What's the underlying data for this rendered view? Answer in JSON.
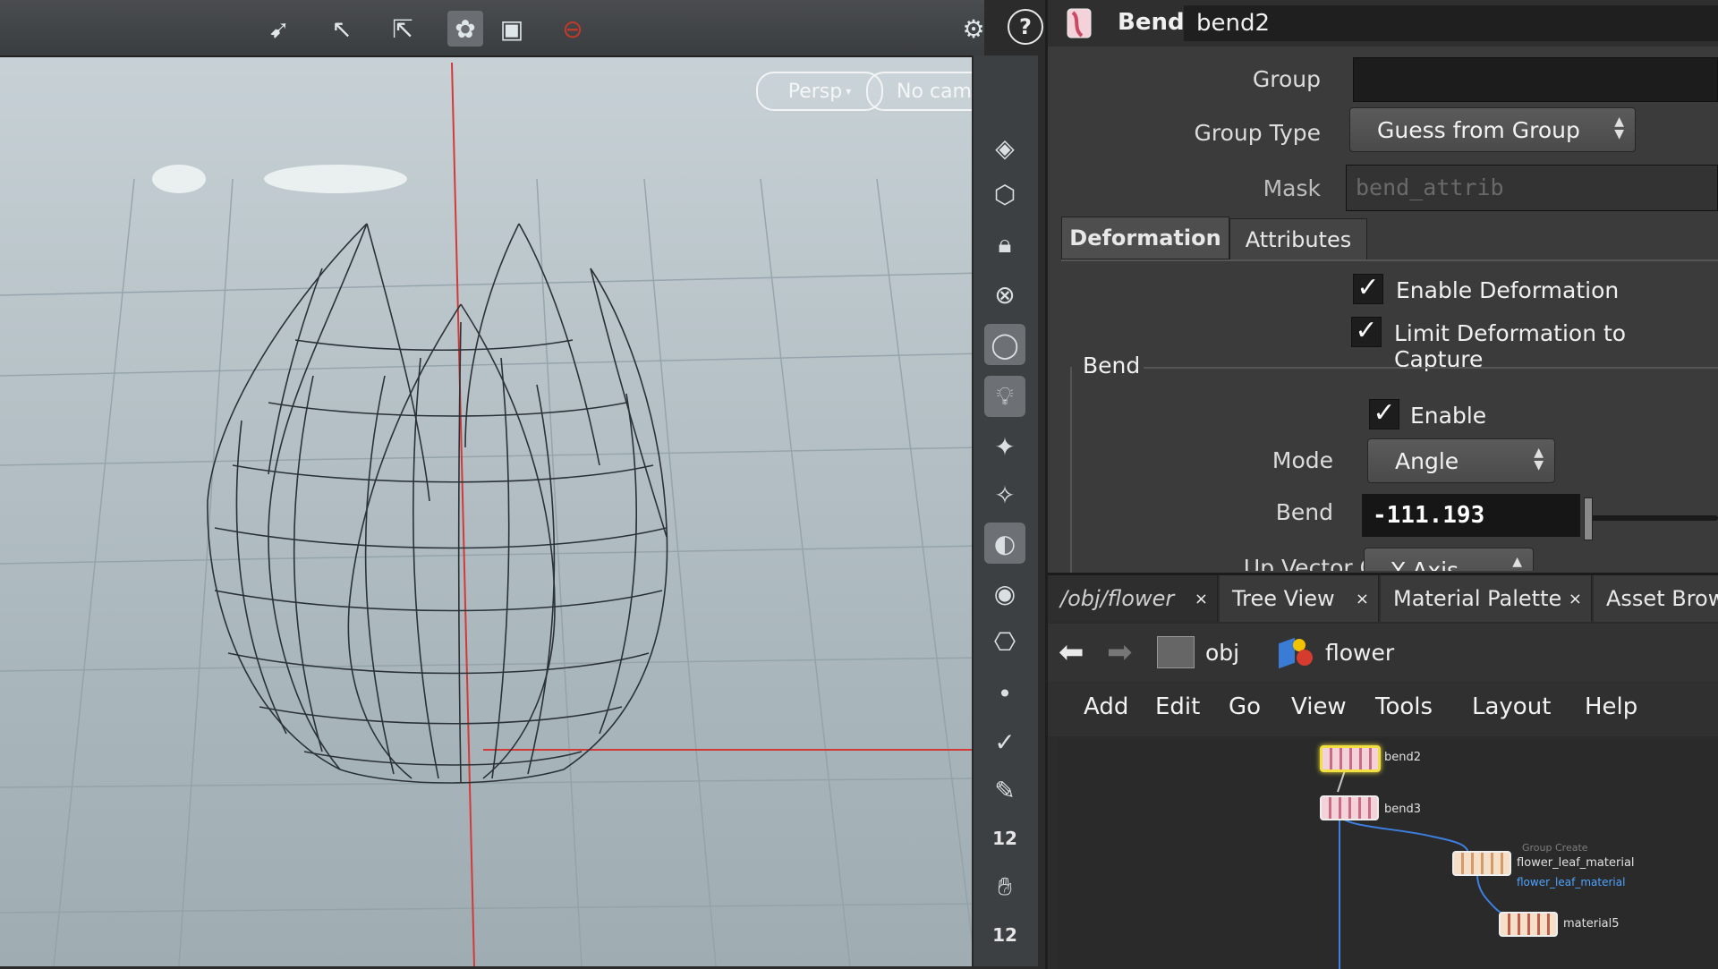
{
  "viewport": {
    "toolbar_icons": [
      "select-arrow-icon",
      "select-pointer-icon",
      "transform-icon",
      "snap-icon",
      "display-icon",
      "no-entry-icon"
    ],
    "view_menu": "Persp",
    "camera_menu": "No cam",
    "background_color": "#b9c4c9"
  },
  "shelf": {
    "icons": [
      "cube-shelf-icon",
      "ghost-icon",
      "lock-icon",
      "cancel-icon",
      "sphere-icon",
      "light-bulb-icon",
      "point-light-icon",
      "spot-light-icon",
      "shading-ball-icon",
      "eye-icon",
      "camera-icon",
      "dot-icon",
      "brush-icon",
      "pen-icon",
      "lasso-icon",
      "eraser-icon"
    ],
    "num_a": "12",
    "num_b": "12"
  },
  "params": {
    "node_type": "Bend",
    "node_name": "bend2",
    "group_label": "Group",
    "group_value": "",
    "group_type_label": "Group Type",
    "group_type_value": "Guess from Group",
    "mask_label": "Mask",
    "mask_placeholder": "bend_attrib",
    "tabs": [
      "Deformation",
      "Attributes"
    ],
    "enable_deformation": "Enable Deformation",
    "limit_deformation": "Limit Deformation to Capture",
    "bend_section": "Bend",
    "enable_label": "Enable",
    "mode_label": "Mode",
    "mode_value": "Angle",
    "bend_label": "Bend",
    "bend_value": "-111.193",
    "upvector_label": "Up Vector Control",
    "upvector_value": "Y Axis"
  },
  "network": {
    "tabs": [
      {
        "label": "/obj/flower",
        "close": "×"
      },
      {
        "label": "Tree View",
        "close": "×"
      },
      {
        "label": "Material Palette",
        "close": "×"
      },
      {
        "label": "Asset Brow"
      }
    ],
    "path": {
      "obj": "obj",
      "flower": "flower"
    },
    "menu": [
      "Add",
      "Edit",
      "Go",
      "View",
      "Tools",
      "Layout",
      "Help"
    ],
    "nodes": {
      "bend2": "bend2",
      "bend3": "bend3",
      "group_hint": "Group Create",
      "flower_leaf_material": "flower_leaf_material",
      "flower_leaf_material_sub": "flower_leaf_material",
      "material5": "material5"
    },
    "accent": "#f1e040"
  }
}
